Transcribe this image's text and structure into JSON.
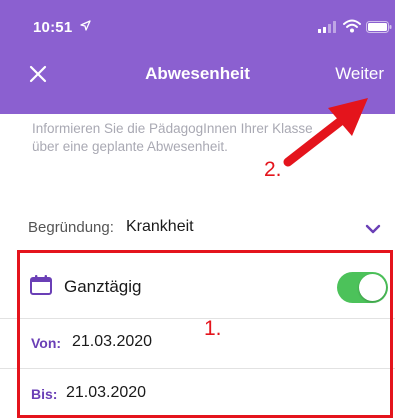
{
  "status_bar": {
    "time": "10:51"
  },
  "nav": {
    "title": "Abwesenheit",
    "next_label": "Weiter"
  },
  "info_text": "Informieren Sie die PädagogInnen Ihrer Klasse über eine geplante Abwesenheit.",
  "reason": {
    "label": "Begründung:",
    "value": "Krankheit"
  },
  "all_day": {
    "label": "Ganztägig",
    "enabled": true
  },
  "from": {
    "label": "Von:",
    "value": "21.03.2020"
  },
  "to": {
    "label": "Bis:",
    "value": "21.03.2020"
  },
  "annotations": {
    "step1": "1.",
    "step2": "2."
  },
  "colors": {
    "header": "#8b60d0",
    "accent": "#6a3fb6",
    "toggle_on": "#4cc25a",
    "annotation": "#e4141c"
  }
}
